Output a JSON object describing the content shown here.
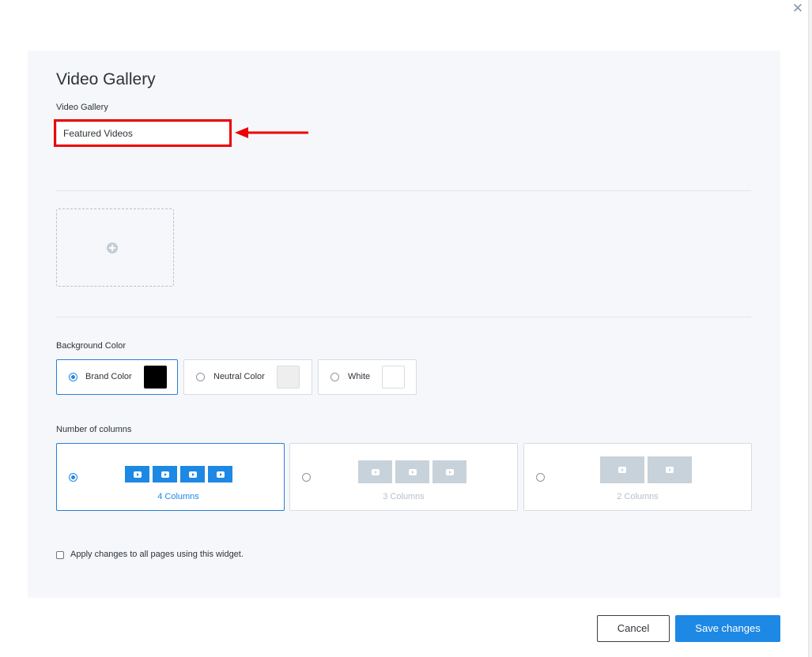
{
  "dialog": {
    "title": "Video Gallery",
    "field_label": "Video Gallery",
    "field_value": "Featured Videos"
  },
  "background": {
    "label": "Background Color",
    "options": [
      {
        "label": "Brand Color",
        "swatch": "#000000",
        "selected": true
      },
      {
        "label": "Neutral Color",
        "swatch": "#eeeeee",
        "selected": false
      },
      {
        "label": "White",
        "swatch": "#ffffff",
        "selected": false
      }
    ]
  },
  "columns": {
    "label": "Number of columns",
    "options": [
      {
        "label": "4 Columns",
        "selected": true
      },
      {
        "label": "3 Columns",
        "selected": false
      },
      {
        "label": "2 Columns",
        "selected": false
      }
    ]
  },
  "apply_all": {
    "label": "Apply changes to all pages using this widget.",
    "checked": false
  },
  "footer": {
    "cancel_label": "Cancel",
    "save_label": "Save changes"
  },
  "colors": {
    "accent": "#1e88e5",
    "highlight": "#ee0000",
    "panel": "#f5f7fa"
  }
}
